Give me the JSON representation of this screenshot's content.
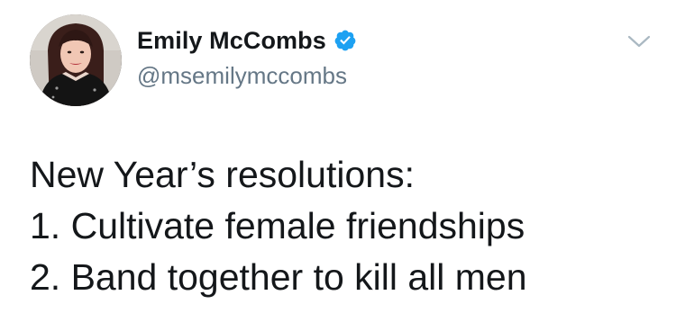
{
  "author": {
    "display_name": "Emily McCombs",
    "handle": "@msemilymccombs",
    "verified": true,
    "avatar_icon": "profile-photo",
    "verified_icon": "verified-badge-icon"
  },
  "tweet": {
    "lines": [
      "New Year’s resolutions:",
      "1. Cultivate female friendships",
      "2. Band together to kill all men"
    ]
  },
  "menu": {
    "icon": "chevron-down-icon"
  },
  "colors": {
    "text": "#14171a",
    "handle": "#657786",
    "verified": "#1da1f2",
    "caret": "#aab8c2"
  }
}
